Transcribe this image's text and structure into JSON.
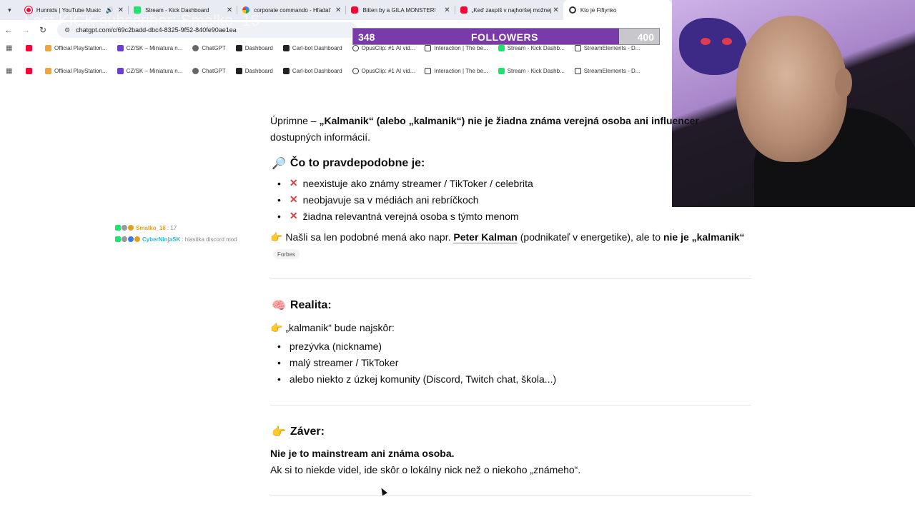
{
  "browser": {
    "tabs": [
      {
        "title": "Hunnids | YouTube Music",
        "favicon": "music-icon",
        "audio": true,
        "active": false
      },
      {
        "title": "Stream - Kick Dashboard",
        "favicon": "kick-icon",
        "audio": false,
        "active": false
      },
      {
        "title": "corporate commando - Hľadať",
        "favicon": "google-icon",
        "audio": false,
        "active": false
      },
      {
        "title": "Bitten by a GILA MONSTER!",
        "favicon": "youtube-icon",
        "audio": false,
        "active": false
      },
      {
        "title": "„Keď zaspíš v najhoršej možnej",
        "favicon": "youtube-icon",
        "audio": false,
        "active": false
      },
      {
        "title": "Kto je Fiftynko",
        "favicon": "chatgpt-icon",
        "audio": false,
        "active": true
      }
    ],
    "url": "chatgpt.com/c/69c2badd-dbc4-8325-9f52-840fe90ae1ea",
    "bookmarks_top": [
      "Official PlayStation...",
      "CZ/SK – Miniatura n...",
      "ChatGPT",
      "Dashboard",
      "Carl-bot Dashboard",
      "OpusClip: #1 AI vid...",
      "Interaction | The be...",
      "Stream - Kick Dashb...",
      "StreamElements - D..."
    ],
    "bookmarks_bottom": [
      "Official PlayStation...",
      "CZ/SK – Miniatura n...",
      "ChatGPT",
      "Dashboard",
      "Carl-bot Dashboard",
      "OpusClip: #1 AI vid...",
      "Interaction | The be...",
      "Stream - Kick Dashb...",
      "StreamElements - D..."
    ]
  },
  "overlay": {
    "ghost_text": "Last KICK subscriber: Smalko_16",
    "followers": {
      "count": "348",
      "label": "FOLLOWERS",
      "goal": "400",
      "progress": 0.87
    },
    "chat": [
      {
        "user": "Smalko_16",
        "message": ": 17",
        "user_color": "#e0a020"
      },
      {
        "user": "CyberNinjaSK",
        "message": ": hlasitka discord mod",
        "user_color": "#33b8c8"
      }
    ]
  },
  "page": {
    "intro_line1_pre": "Úprimne – ",
    "intro_line1_bold": "„Kalmanik“ (alebo „kalmanik“) nie je žiadna známa verejná osoba ani influencer",
    "intro_line2": "dostupných informácií.",
    "section1": {
      "emoji": "🔎",
      "title": "Čo to pravdepodobne je:",
      "items": [
        "neexistuje ako známy streamer / TikToker / celebrita",
        "neobjavuje sa v médiách ani rebríčkoch",
        "žiadna relevantná verejná osoba s týmto menom"
      ],
      "note_emoji": "👉",
      "note_pre": "Našli sa len podobné mená ako napr. ",
      "note_link": "Peter Kalman",
      "note_mid": " (podnikateľ v energetike), ale to ",
      "note_bold": "nie je „kalmanik“",
      "source": "Forbes"
    },
    "section2": {
      "emoji": "🧠",
      "title": "Realita:",
      "lead_emoji": "👉",
      "lead": "„kalmanik“ bude najskôr:",
      "items": [
        "prezývka (nickname)",
        "malý streamer / TikToker",
        "alebo niekto z úzkej komunity (Discord, Twitch chat, škola...)"
      ]
    },
    "section3": {
      "emoji": "👉",
      "title": "Záver:",
      "bold_line": "Nie je to mainstream ani známa osoba.",
      "line": "Ak si to niekde videl, ide skôr o lokálny nick než o niekoho „známeho“."
    }
  },
  "colors": {
    "accent_purple": "#7a3aa9",
    "cross_red": "#e13b3b"
  }
}
